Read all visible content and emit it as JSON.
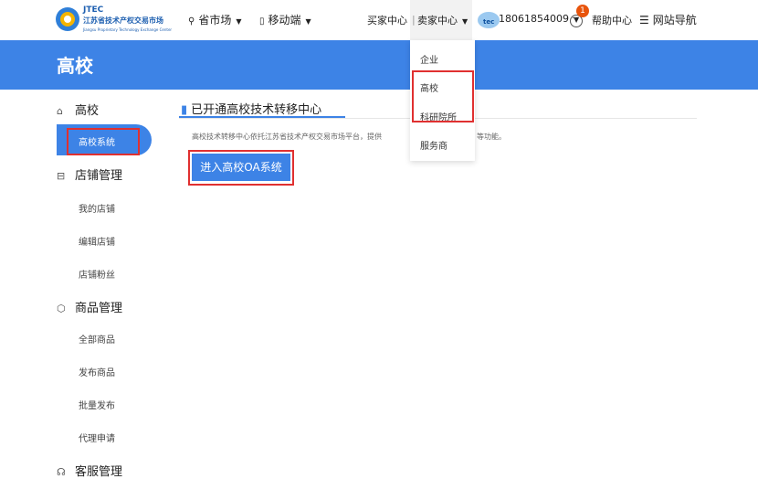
{
  "header": {
    "logo": {
      "abbr": "JTEC",
      "name": "江苏省技术产权交易市场",
      "english": "Jiangsu Proprietary Technology Exchange Center"
    },
    "nav": {
      "province_market": "省市场",
      "mobile": "移动端",
      "buyer_center": "买家中心",
      "divider": "|",
      "seller_center": "卖家中心",
      "account": "18061854009",
      "notification_count": "1",
      "help_center": "帮助中心",
      "site_nav": "网站导航"
    },
    "icons": {
      "location": "location-pin-icon",
      "mobile": "mobile-phone-icon",
      "menu": "menu-lines-icon"
    }
  },
  "seller_dropdown": {
    "items": [
      "企业",
      "高校",
      "科研院所",
      "服务商"
    ]
  },
  "banner": {
    "title": "高校"
  },
  "sidebar": {
    "sections": [
      {
        "label": "高校",
        "icon": "home-icon",
        "items": [
          "高校系统"
        ]
      },
      {
        "label": "店铺管理",
        "icon": "store-icon",
        "items": [
          "我的店铺",
          "编辑店铺",
          "店铺粉丝"
        ]
      },
      {
        "label": "商品管理",
        "icon": "cube-icon",
        "items": [
          "全部商品",
          "发布商品",
          "批量发布",
          "代理申请"
        ]
      },
      {
        "label": "客服管理",
        "icon": "headset-icon",
        "items": []
      }
    ]
  },
  "main": {
    "title": "已开通高校技术转移中心",
    "desc": "高校技术转移中心依托江苏省技术产权交易市场平台，提供",
    "desc_tail": "等功能。",
    "oa_button": "进入高校OA系统"
  },
  "colors": {
    "primary": "#3d83e6",
    "highlight": "#e03030",
    "badge": "#e8540c"
  }
}
